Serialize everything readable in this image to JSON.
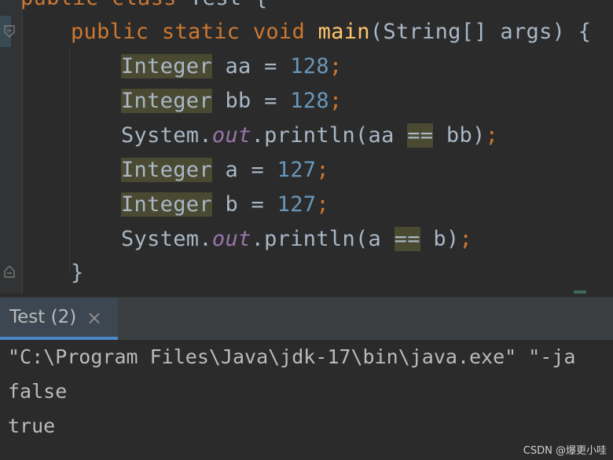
{
  "editor": {
    "line0": {
      "kw1": "public",
      "kw2": "class",
      "name": "Test",
      "brace": "{"
    },
    "line1": {
      "kw1": "public",
      "kw2": "static",
      "kw3": "void",
      "method": "main",
      "params": "(String[] args) {"
    },
    "line2": {
      "type": "Integer",
      "rest": " aa = ",
      "num": "128",
      "semi": ";"
    },
    "line3": {
      "type": "Integer",
      "rest": " bb = ",
      "num": "128",
      "semi": ";"
    },
    "line4": {
      "pre": "System.",
      "field": "out",
      "mid": ".println(aa ",
      "op": "==",
      "post": " bb)",
      "semi": ";"
    },
    "line5": {
      "type": "Integer",
      "rest": " a = ",
      "num": "127",
      "semi": ";"
    },
    "line6": {
      "type": "Integer",
      "rest": " b = ",
      "num": "127",
      "semi": ";"
    },
    "line7": {
      "pre": "System.",
      "field": "out",
      "mid": ".println(a ",
      "op": "==",
      "post": " b)",
      "semi": ";"
    },
    "line8": {
      "brace": "}"
    }
  },
  "run_panel": {
    "tab_label": "Test (2)",
    "close_glyph": "×"
  },
  "console": {
    "command": "\"C:\\Program Files\\Java\\jdk-17\\bin\\java.exe\" \"-ja",
    "out1": "false",
    "out2": "true"
  },
  "watermark": "CSDN @爆更小哇",
  "icons": [
    "fold-open-icon",
    "fold-close-icon",
    "close-icon"
  ]
}
